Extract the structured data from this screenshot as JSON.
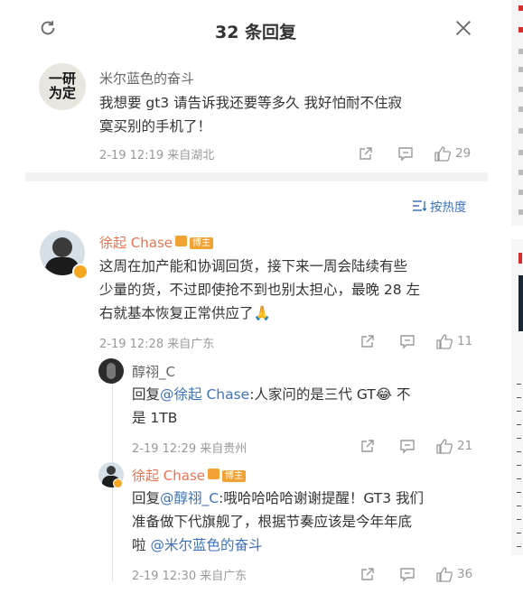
{
  "header": {
    "title": "32 条回复"
  },
  "root_comment": {
    "author": "米尔蓝色的奋斗",
    "avatar_text": "一研为定",
    "text": "我想要gt3 请告诉我还要等多久 我好怕耐不住寂寞买别的手机了！",
    "line1": "我想要 gt3 请告诉我还要等多久 我好怕耐不住寂",
    "line2": "寞买别的手机了！",
    "meta": "2-19 12:19  来自湖北",
    "likes": "29"
  },
  "sort": {
    "label": "按热度"
  },
  "replies": [
    {
      "author": "徐起 Chase",
      "badge": "博主",
      "line1": "这周在加产能和协调回货，接下来一周会陆续有些",
      "line2": "少量的货，不过即使抢不到也别太担心，最晚 28 左",
      "line3": "右就基本恢复正常供应了🙏",
      "meta": "2-19 12:28  来自广东",
      "likes": "11"
    },
    {
      "author": "醇祤_C",
      "reply_prefix": "回复",
      "mention": "@徐起 Chase",
      "line1_rest": ":人家问的是三代 GT😂  不",
      "line2": "是 1TB",
      "meta": "2-19 12:29  来自贵州",
      "likes": "21"
    },
    {
      "author": "徐起 Chase",
      "badge": "博主",
      "reply_prefix": "回复",
      "mention": "@醇祤_C",
      "line1_rest": ":哦哈哈哈哈谢谢提醒！GT3 我们",
      "line2": "准备做下代旗舰了，根据节奏应该是今年年底",
      "line3_prefix": "啦 ",
      "line3_mention": "@米尔蓝色的奋斗",
      "meta": "2-19 12:30  来自广东",
      "likes": "36"
    }
  ],
  "icons": [
    "refresh-icon",
    "close-icon",
    "share-icon",
    "comment-icon",
    "like-icon",
    "sort-icon",
    "verified-icon"
  ],
  "colors": {
    "accent_name": "#eb7350",
    "link": "#3d72b8",
    "badge": "#f2a133",
    "muted": "#999999"
  }
}
